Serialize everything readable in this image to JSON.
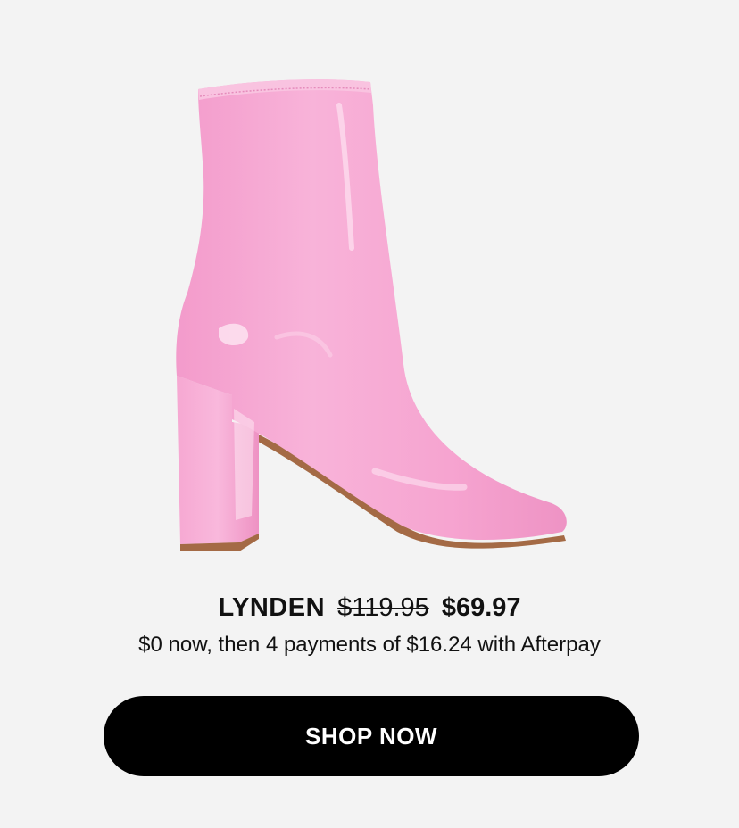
{
  "product": {
    "name": "LYNDEN",
    "original_price": "$119.95",
    "sale_price": "$69.97",
    "installment_text": "$0 now, then 4 payments of $16.24 with Afterpay",
    "image_icon": "pink-patent-ankle-boot"
  },
  "cta": {
    "label": "SHOP NOW"
  },
  "colors": {
    "background": "#f3f3f3",
    "boot_pink": "#f7a9d4",
    "button_bg": "#000000",
    "button_text": "#ffffff"
  }
}
